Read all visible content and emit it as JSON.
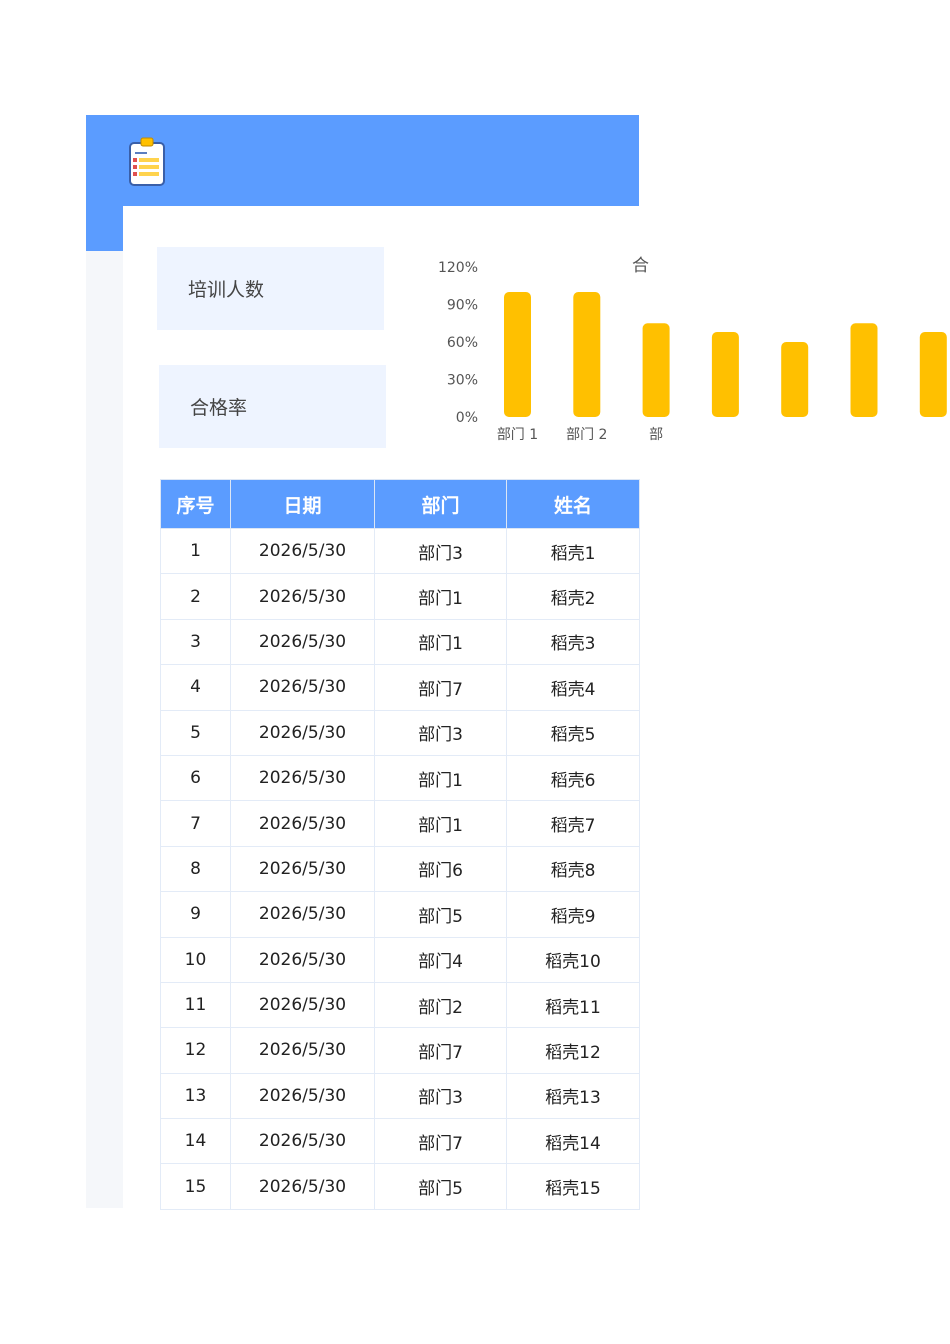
{
  "header": {
    "icon": "clipboard-icon",
    "color": "#5b9cff"
  },
  "cards": [
    {
      "label": "培训人数"
    },
    {
      "label": "合格率"
    }
  ],
  "chart_data": {
    "type": "bar",
    "title": "合",
    "categories": [
      "部门 1",
      "部门 2",
      "部",
      "",
      "",
      "",
      ""
    ],
    "values": [
      1.0,
      1.0,
      0.75,
      0.68,
      0.6,
      0.75,
      0.68
    ],
    "yticks": [
      "0%",
      "30%",
      "60%",
      "90%",
      "120%"
    ],
    "ylim": [
      0,
      1.2
    ],
    "color": "#ffc000"
  },
  "table": {
    "columns": [
      "序号",
      "日期",
      "部门",
      "姓名"
    ],
    "rows": [
      [
        "1",
        "2026/5/30",
        "部门3",
        "稻壳1"
      ],
      [
        "2",
        "2026/5/30",
        "部门1",
        "稻壳2"
      ],
      [
        "3",
        "2026/5/30",
        "部门1",
        "稻壳3"
      ],
      [
        "4",
        "2026/5/30",
        "部门7",
        "稻壳4"
      ],
      [
        "5",
        "2026/5/30",
        "部门3",
        "稻壳5"
      ],
      [
        "6",
        "2026/5/30",
        "部门1",
        "稻壳6"
      ],
      [
        "7",
        "2026/5/30",
        "部门1",
        "稻壳7"
      ],
      [
        "8",
        "2026/5/30",
        "部门6",
        "稻壳8"
      ],
      [
        "9",
        "2026/5/30",
        "部门5",
        "稻壳9"
      ],
      [
        "10",
        "2026/5/30",
        "部门4",
        "稻壳10"
      ],
      [
        "11",
        "2026/5/30",
        "部门2",
        "稻壳11"
      ],
      [
        "12",
        "2026/5/30",
        "部门7",
        "稻壳12"
      ],
      [
        "13",
        "2026/5/30",
        "部门3",
        "稻壳13"
      ],
      [
        "14",
        "2026/5/30",
        "部门7",
        "稻壳14"
      ],
      [
        "15",
        "2026/5/30",
        "部门5",
        "稻壳15"
      ]
    ]
  }
}
